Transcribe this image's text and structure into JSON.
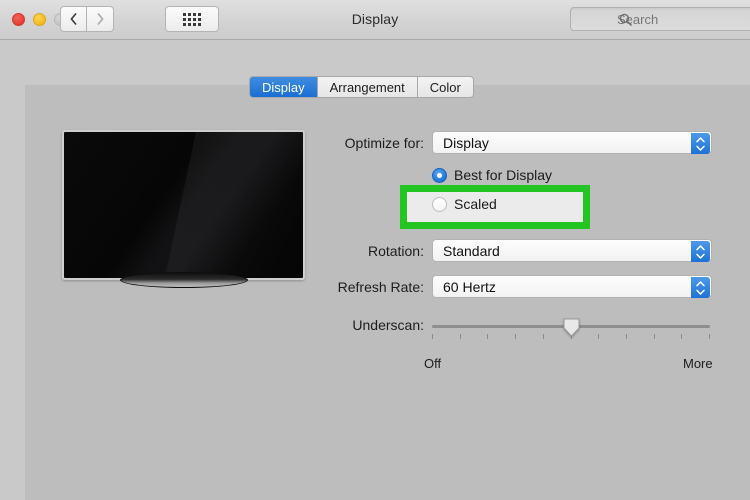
{
  "window": {
    "title": "Display",
    "traffic_lights": [
      {
        "name": "close",
        "color": "#e33e35",
        "enabled": true
      },
      {
        "name": "minimize",
        "color": "#f2bb1e",
        "enabled": true
      },
      {
        "name": "zoom",
        "color": "#c4c4c4",
        "enabled": false
      }
    ],
    "nav": {
      "back_icon": "chevron-left-icon",
      "forward_icon": "chevron-right-icon",
      "grid_icon": "show-all-grid-icon"
    }
  },
  "search": {
    "icon": "search-icon",
    "placeholder": "Search",
    "value": ""
  },
  "tabs": [
    {
      "label": "Display",
      "active": true
    },
    {
      "label": "Arrangement",
      "active": false
    },
    {
      "label": "Color",
      "active": false
    }
  ],
  "preview": {
    "device_icon": "television-display-icon",
    "screen_color": "#0a0a0a"
  },
  "controls": {
    "optimize_for": {
      "label": "Optimize for:",
      "value": "Display",
      "stepper_icon": "stepper-up-down-icon"
    },
    "resolution_options": [
      {
        "label": "Best for Display",
        "selected": true
      },
      {
        "label": "Scaled",
        "selected": false
      }
    ],
    "rotation": {
      "label": "Rotation:",
      "value": "Standard",
      "stepper_icon": "stepper-up-down-icon"
    },
    "refresh_rate": {
      "label": "Refresh Rate:",
      "value": "60 Hertz",
      "stepper_icon": "stepper-up-down-icon"
    },
    "underscan": {
      "label": "Underscan:",
      "min_label": "Off",
      "max_label": "More",
      "tick_count": 11,
      "value_percent": 50
    }
  },
  "annotation": {
    "target": "Scaled",
    "border_color": "#22c522",
    "fill_color": "#ebebeb"
  }
}
